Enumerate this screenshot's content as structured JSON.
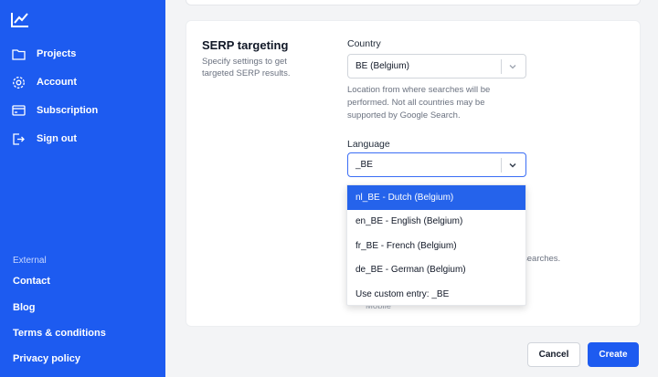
{
  "sidebar": {
    "items": [
      {
        "label": "Projects",
        "icon": "folder-icon"
      },
      {
        "label": "Account",
        "icon": "gear-icon"
      },
      {
        "label": "Subscription",
        "icon": "credit-card-icon"
      },
      {
        "label": "Sign out",
        "icon": "sign-out-icon"
      }
    ],
    "external_title": "External",
    "external_links": [
      "Contact",
      "Blog",
      "Terms & conditions",
      "Privacy policy"
    ]
  },
  "section": {
    "title": "SERP targeting",
    "description": "Specify settings to get targeted SERP results."
  },
  "country": {
    "label": "Country",
    "value": "BE (Belgium)",
    "help": "Location from where searches will be performed. Not all countries may be supported by Google Search."
  },
  "language": {
    "label": "Language",
    "value": "_BE",
    "options": [
      "nl_BE - Dutch (Belgium)",
      "en_BE - English (Belgium)",
      "fr_BE - French (Belgium)",
      "de_BE - German (Belgium)",
      "Use custom entry: _BE"
    ]
  },
  "obscured": {
    "searches_fragment": "searches.",
    "device_fragment": "Mobile"
  },
  "buttons": {
    "cancel": "Cancel",
    "create": "Create"
  },
  "colors": {
    "brand": "#1d5bf0",
    "highlight": "#2563eb"
  }
}
